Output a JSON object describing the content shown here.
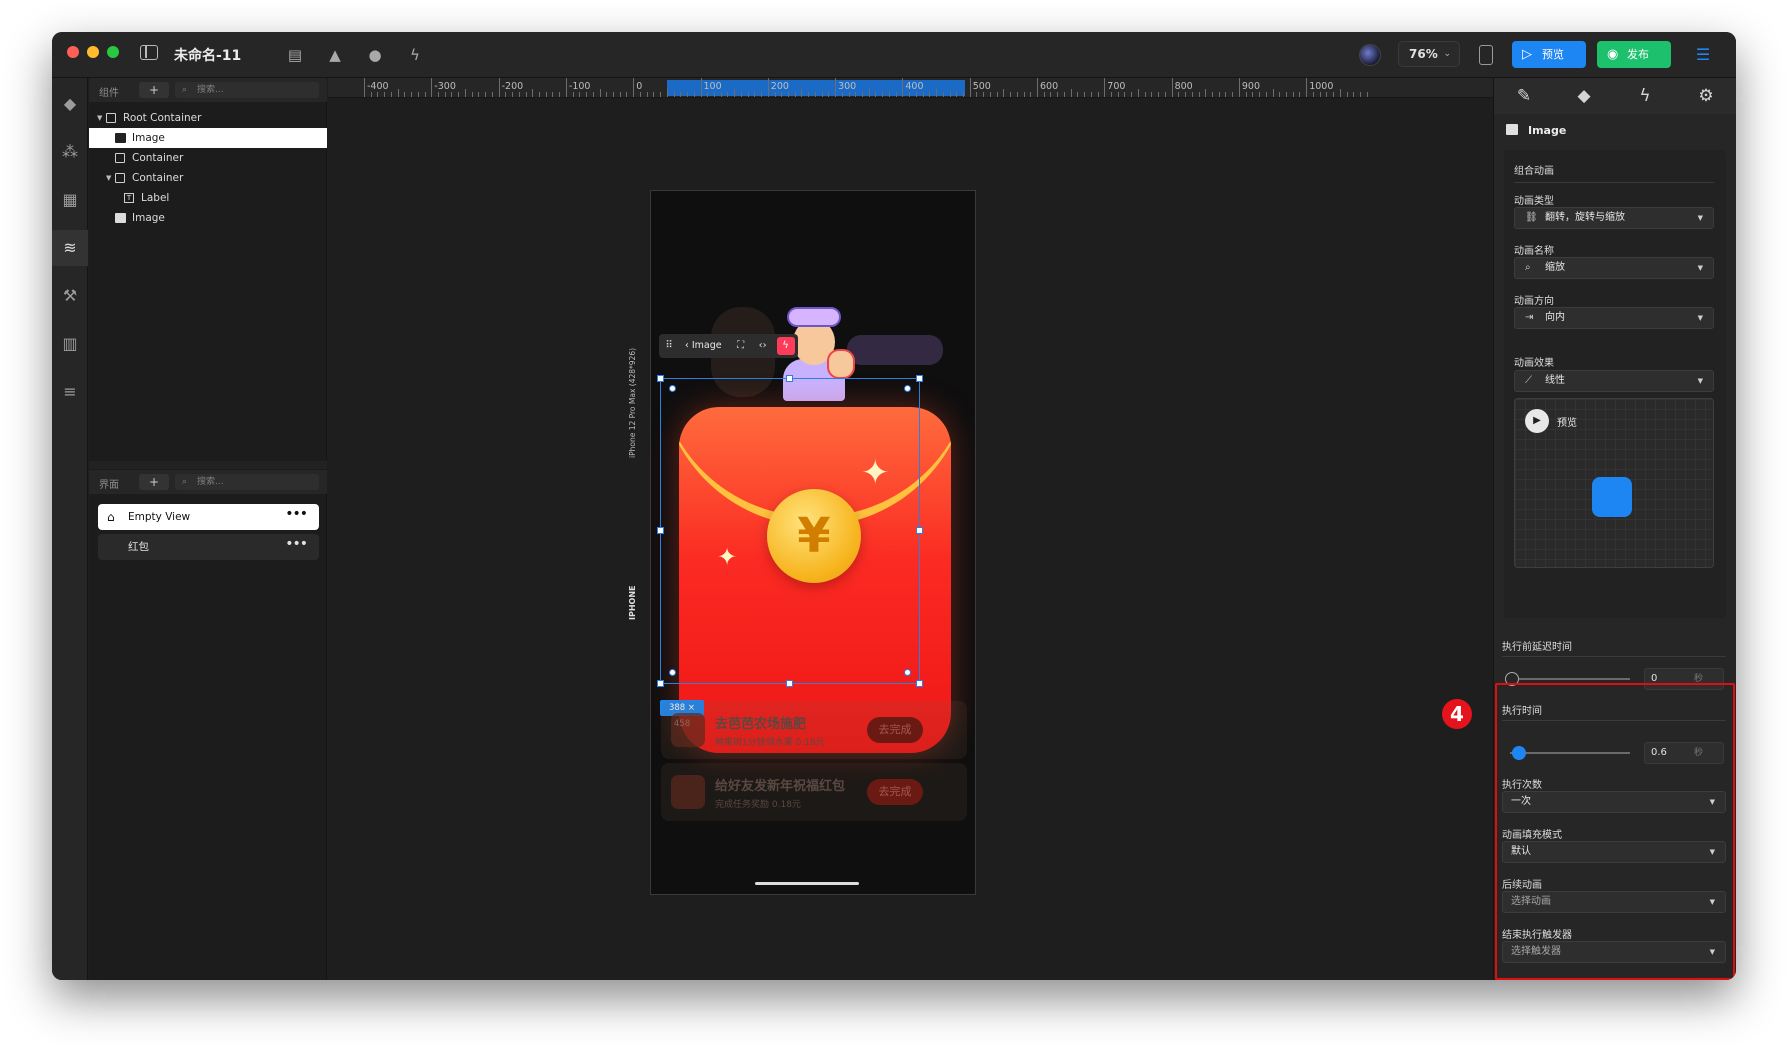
{
  "window": {
    "doc_title": "未命名-11",
    "zoom": "76%",
    "preview_btn": "预览",
    "publish_btn": "发布"
  },
  "left_panel": {
    "components_label": "组件",
    "add": "+",
    "search_placeholder": "搜索...",
    "tree": [
      {
        "label": "Root Container",
        "icon": "container-icon",
        "expanded": true,
        "depth": 0
      },
      {
        "label": "Image",
        "icon": "image-icon",
        "selected": true,
        "depth": 1
      },
      {
        "label": "Container",
        "icon": "container-icon",
        "depth": 1
      },
      {
        "label": "Container",
        "icon": "container-icon",
        "expanded": true,
        "depth": 1
      },
      {
        "label": "Label",
        "icon": "label-icon",
        "depth": 2
      },
      {
        "label": "Image",
        "icon": "image-icon",
        "depth": 1
      }
    ],
    "screens_label": "界面",
    "screens": [
      {
        "label": "Empty View",
        "active": true
      },
      {
        "label": "红包",
        "active": false
      }
    ]
  },
  "canvas": {
    "ruler_labels": [
      "-400",
      "-300",
      "-200",
      "-100",
      "0",
      "100",
      "200",
      "300",
      "400",
      "500",
      "600",
      "700",
      "800",
      "900",
      "1000"
    ],
    "device_label": "iPhone 12 Pro Max (428*926)",
    "device_type": "IPHONE",
    "selected_element": "Image",
    "size_badge": "388 × 458",
    "app": {
      "coin_symbol": "¥",
      "tasks": [
        {
          "title": "去芭芭农场施肥",
          "sub": "种果树1分钱领水果",
          "reward": "0.18元",
          "action": "去完成"
        },
        {
          "title": "给好友发新年祝福红包",
          "sub": "完成任务奖励",
          "reward": "0.18元",
          "action": "去完成"
        }
      ]
    }
  },
  "inspector": {
    "tabs": [
      "brush-icon",
      "diamond-icon",
      "bolt-icon",
      "component-icon"
    ],
    "element_title": "Image",
    "section_title": "组合动画",
    "animation_type_label": "动画类型",
    "animation_type_value": "翻转，旋转与缩放",
    "animation_name_label": "动画名称",
    "animation_name_value": "缩放",
    "animation_direction_label": "动画方向",
    "animation_direction_value": "向内",
    "animation_effect_label": "动画效果",
    "animation_effect_value": "线性",
    "preview_label": "预览",
    "delay_label": "执行前延迟时间",
    "delay_value": "0",
    "delay_fraction": 0.0,
    "unit": "秒",
    "duration_label": "执行时间",
    "duration_value": "0.6",
    "duration_fraction": 0.06,
    "repeat_label": "执行次数",
    "repeat_value": "一次",
    "fill_mode_label": "动画填充模式",
    "fill_mode_value": "默认",
    "next_anim_label": "后续动画",
    "next_anim_placeholder": "选择动画",
    "end_trigger_label": "结束执行触发器",
    "end_trigger_placeholder": "选择触发器"
  },
  "annotation": {
    "step_number": "4"
  },
  "colors": {
    "accent_blue": "#1e86f2",
    "publish_green": "#1cc06d",
    "highlight_red": "#e00f0f"
  }
}
